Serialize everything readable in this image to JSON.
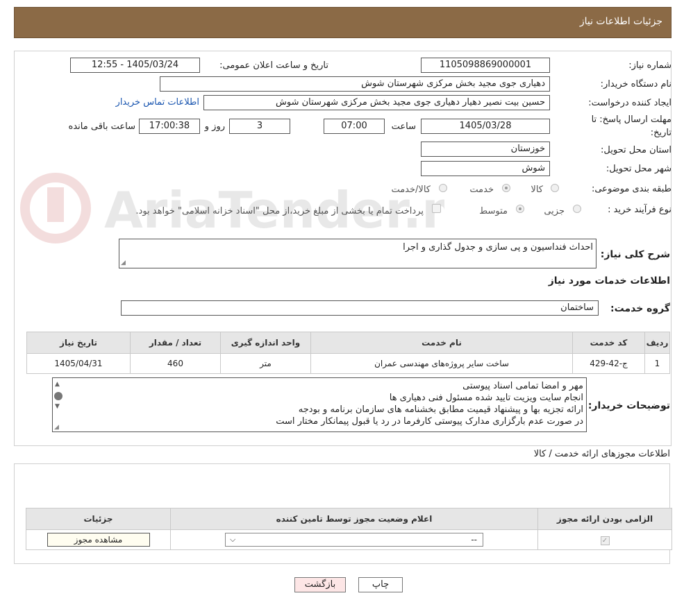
{
  "header": {
    "title": "جزئیات اطلاعات نیاز"
  },
  "form": {
    "need_number_label": "شماره نیاز:",
    "need_number": "1105098869000001",
    "announce_label": "تاریخ و ساعت اعلان عمومی:",
    "announce_value": "1405/03/24 - 12:55",
    "buyer_org_label": "نام دستگاه خریدار:",
    "buyer_org": "دهیاری جوی مجید بخش مرکزی شهرستان شوش",
    "requester_label": "ایجاد کننده درخواست:",
    "requester": "حسین بیت نصیر دهیار دهیاری جوی مجید بخش مرکزی شهرستان شوش",
    "contact_link": "اطلاعات تماس خریدار",
    "deadline_label_line1": "مهلت ارسال پاسخ: تا",
    "deadline_label_line2": "تاریخ:",
    "deadline_date": "1405/03/28",
    "time_label": "ساعت",
    "deadline_time": "07:00",
    "days_value": "3",
    "days_label": "روز و",
    "remaining_time": "17:00:38",
    "remaining_label": "ساعت باقی مانده",
    "province_label": "استان محل تحویل:",
    "province": "خوزستان",
    "city_label": "شهر محل تحویل:",
    "city": "شوش",
    "category_label": "طبقه بندی موضوعی:",
    "category_options": [
      "کالا",
      "خدمت",
      "کالا/خدمت"
    ],
    "purchase_type_label": "نوع فرآیند خرید :",
    "purchase_options": [
      "جزیی",
      "متوسط"
    ],
    "treasury_note": "پرداخت تمام یا بخشی از مبلغ خرید،از محل \"اسناد خزانه اسلامی\" خواهد بود.",
    "general_desc_label": "شرح کلی نیاز:",
    "general_desc": "احداث فنداسیون و پی سازی و جدول گذاری و اجرا",
    "services_section_title": "اطلاعات خدمات مورد نیاز",
    "service_group_label": "گروه خدمت:",
    "service_group": "ساختمان"
  },
  "services_table": {
    "headers": [
      "ردیف",
      "کد خدمت",
      "نام خدمت",
      "واحد اندازه گیری",
      "تعداد / مقدار",
      "تاریخ نیاز"
    ],
    "rows": [
      {
        "row": "1",
        "code": "ج-42-429",
        "name": "ساخت سایر پروژه‌های مهندسی عمران",
        "unit": "متر",
        "qty": "460",
        "date": "1405/04/31"
      }
    ]
  },
  "buyer_notes": {
    "label": "توضیحات خریدار:",
    "lines": [
      "مهر و امضا تمامی اسناد پیوستی",
      "انجام سایت ویزیت تایید شده مسئول فنی دهیاری ها",
      "ارائه تجزیه بها و پیشنهاد قیمیت مطابق بخشنامه های سازمان برنامه و بودجه",
      "در صورت عدم بارگزاری مدارک پیوستی کارفرما در رد یا قبول پیمانکار مختار است"
    ]
  },
  "permits": {
    "section_title": "اطلاعات مجوزهای ارائه خدمت / کالا",
    "headers": [
      "الزامی بودن ارائه مجوز",
      "اعلام وضعیت مجوز توسط تامین کننده",
      "جزئیات"
    ],
    "select_value": "--",
    "view_button": "مشاهده مجوز"
  },
  "footer": {
    "back_button": "بازگشت",
    "print_button": "چاپ"
  },
  "watermark": {
    "text": "AriaTender.neT"
  },
  "colors": {
    "header_bg": "#8b6a46",
    "link": "#1a56b0",
    "back_btn_bg": "#fde6e6"
  }
}
